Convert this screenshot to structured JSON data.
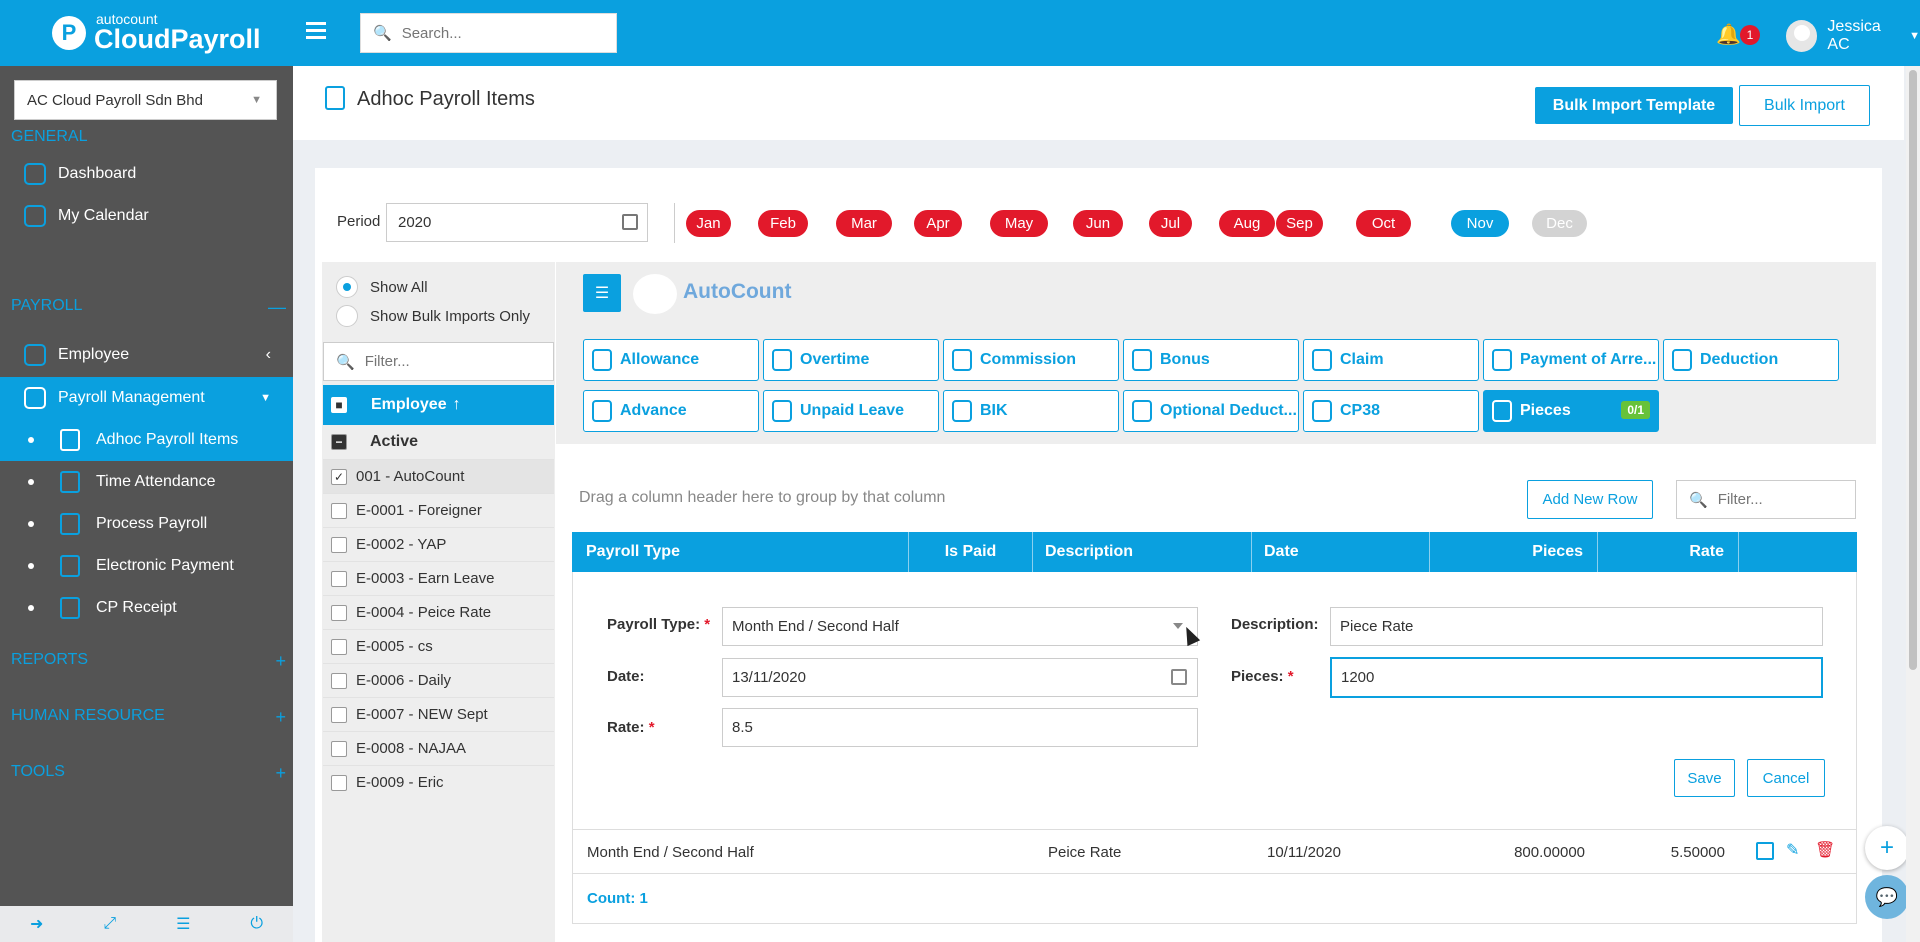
{
  "header": {
    "logo_small": "autocount",
    "logo_big": "CloudPayroll",
    "search_placeholder": "Search...",
    "notification_count": "1",
    "user_name": "Jessica AC"
  },
  "sidebar": {
    "company": "AC Cloud Payroll Sdn Bhd",
    "sections": {
      "general": "GENERAL",
      "payroll": "PAYROLL",
      "reports": "REPORTS",
      "hr": "HUMAN RESOURCE",
      "tools": "TOOLS"
    },
    "general_items": [
      "Dashboard",
      "My Calendar"
    ],
    "payroll_items": [
      "Employee",
      "Payroll Management"
    ],
    "payroll_sub": [
      "Adhoc Payroll Items",
      "Time Attendance",
      "Process Payroll",
      "Electronic Payment",
      "CP Receipt"
    ]
  },
  "page": {
    "title": "Adhoc Payroll Items",
    "bulk_template": "Bulk Import Template",
    "bulk_import": "Bulk Import",
    "period_label": "Period",
    "period_value": "2020",
    "months": [
      "Jan",
      "Feb",
      "Mar",
      "Apr",
      "May",
      "Jun",
      "Jul",
      "Aug",
      "Sep",
      "Oct",
      "Nov",
      "Dec"
    ],
    "month_colors": {
      "default": "#e2192b",
      "current": "#0aa0df",
      "disabled": "#d3d3d3"
    }
  },
  "employees": {
    "show_all": "Show All",
    "show_bulk": "Show Bulk Imports Only",
    "filter_placeholder": "Filter...",
    "header": "Employee",
    "group": "Active",
    "list": [
      "001 - AutoCount",
      "E-0001 - Foreigner",
      "E-0002 - YAP",
      "E-0003 - Earn Leave",
      "E-0004 - Peice Rate",
      "E-0005 - cs",
      "E-0006 - Daily",
      "E-0007 - NEW Sept",
      "E-0008 - NAJAA",
      "E-0009 - Eric"
    ]
  },
  "main": {
    "company_name": "AutoCount",
    "tiles": [
      "Allowance",
      "Overtime",
      "Commission",
      "Bonus",
      "Claim",
      "Payment of Arre...",
      "Deduction",
      "Advance",
      "Unpaid Leave",
      "BIK",
      "Optional Deduct...",
      "CP38",
      "Pieces"
    ],
    "pieces_count": "0/1",
    "drag_hint": "Drag a column header here to group by that column",
    "add_row": "Add New Row",
    "grid_filter_placeholder": "Filter...",
    "columns": [
      "Payroll Type",
      "Is Paid",
      "Description",
      "Date",
      "Pieces",
      "Rate"
    ]
  },
  "form": {
    "payroll_type_label": "Payroll Type:",
    "payroll_type_value": "Month End / Second Half",
    "description_label": "Description:",
    "description_value": "Piece Rate",
    "date_label": "Date:",
    "date_value": "13/11/2020",
    "pieces_label": "Pieces:",
    "pieces_value": "1200",
    "rate_label": "Rate:",
    "rate_value": "8.5",
    "save": "Save",
    "cancel": "Cancel"
  },
  "row": {
    "payroll_type": "Month End / Second Half",
    "description": "Peice Rate",
    "date": "10/11/2020",
    "pieces": "800.00000",
    "rate": "5.50000"
  },
  "count_label": "Count: 1"
}
